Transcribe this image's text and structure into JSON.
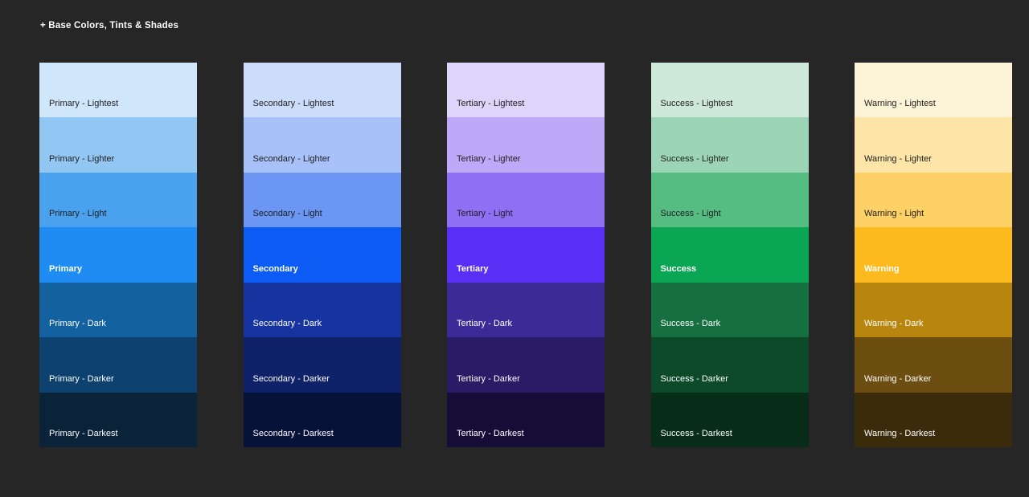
{
  "page": {
    "background": "#262626",
    "title": "+ Base Colors, Tints & Shades",
    "title_color": "#ffffff"
  },
  "palette": {
    "dark_label_color": "#1e1e1e",
    "light_label_color": "#ffffff",
    "columns": [
      {
        "name": "Primary",
        "swatches": [
          {
            "label": "Primary - Lightest",
            "color": "#cfe6fb",
            "text": "#1e1e1e",
            "bold": false
          },
          {
            "label": "Primary - Lighter",
            "color": "#92c7f4",
            "text": "#1e1e1e",
            "bold": false
          },
          {
            "label": "Primary - Light",
            "color": "#4aa2ee",
            "text": "#1e1e1e",
            "bold": false
          },
          {
            "label": "Primary",
            "color": "#1e8cf2",
            "text": "#ffffff",
            "bold": true
          },
          {
            "label": "Primary - Dark",
            "color": "#14619f",
            "text": "#ffffff",
            "bold": false
          },
          {
            "label": "Primary - Darker",
            "color": "#0d4270",
            "text": "#ffffff",
            "bold": false
          },
          {
            "label": "Primary - Darkest",
            "color": "#0a2338",
            "text": "#ffffff",
            "bold": false
          }
        ]
      },
      {
        "name": "Secondary",
        "swatches": [
          {
            "label": "Secondary - Lightest",
            "color": "#ccdcfb",
            "text": "#1e1e1e",
            "bold": false
          },
          {
            "label": "Secondary - Lighter",
            "color": "#a9c1f9",
            "text": "#1e1e1e",
            "bold": false
          },
          {
            "label": "Secondary - Light",
            "color": "#6b96f4",
            "text": "#1e1e1e",
            "bold": false
          },
          {
            "label": "Secondary",
            "color": "#0c5bf5",
            "text": "#ffffff",
            "bold": true
          },
          {
            "label": "Secondary - Dark",
            "color": "#17339f",
            "text": "#ffffff",
            "bold": false
          },
          {
            "label": "Secondary - Darker",
            "color": "#0f2169",
            "text": "#ffffff",
            "bold": false
          },
          {
            "label": "Secondary - Darkest",
            "color": "#071239",
            "text": "#ffffff",
            "bold": false
          }
        ]
      },
      {
        "name": "Tertiary",
        "swatches": [
          {
            "label": "Tertiary - Lightest",
            "color": "#ded6fa",
            "text": "#1e1e1e",
            "bold": false
          },
          {
            "label": "Tertiary - Lighter",
            "color": "#bda9f7",
            "text": "#1e1e1e",
            "bold": false
          },
          {
            "label": "Tertiary - Light",
            "color": "#8f70f5",
            "text": "#1e1e1e",
            "bold": false
          },
          {
            "label": "Tertiary",
            "color": "#5a2ff5",
            "text": "#ffffff",
            "bold": true
          },
          {
            "label": "Tertiary - Dark",
            "color": "#3c2b96",
            "text": "#ffffff",
            "bold": false
          },
          {
            "label": "Tertiary - Darker",
            "color": "#2a1b66",
            "text": "#ffffff",
            "bold": false
          },
          {
            "label": "Tertiary - Darkest",
            "color": "#160c38",
            "text": "#ffffff",
            "bold": false
          }
        ]
      },
      {
        "name": "Success",
        "swatches": [
          {
            "label": "Success - Lightest",
            "color": "#cee9da",
            "text": "#1e1e1e",
            "bold": false
          },
          {
            "label": "Success - Lighter",
            "color": "#9cd5b5",
            "text": "#1e1e1e",
            "bold": false
          },
          {
            "label": "Success - Light",
            "color": "#55bd82",
            "text": "#1e1e1e",
            "bold": false
          },
          {
            "label": "Success",
            "color": "#0ba653",
            "text": "#ffffff",
            "bold": true
          },
          {
            "label": "Success - Dark",
            "color": "#156f40",
            "text": "#ffffff",
            "bold": false
          },
          {
            "label": "Success - Darker",
            "color": "#0d4a2a",
            "text": "#ffffff",
            "bold": false
          },
          {
            "label": "Success - Darkest",
            "color": "#072c18",
            "text": "#ffffff",
            "bold": false
          }
        ]
      },
      {
        "name": "Warning",
        "swatches": [
          {
            "label": "Warning - Lightest",
            "color": "#fdf3d6",
            "text": "#1e1e1e",
            "bold": false
          },
          {
            "label": "Warning - Lighter",
            "color": "#fce5a6",
            "text": "#1e1e1e",
            "bold": false
          },
          {
            "label": "Warning - Light",
            "color": "#fdd166",
            "text": "#1e1e1e",
            "bold": false
          },
          {
            "label": "Warning",
            "color": "#fcba1e",
            "text": "#ffffff",
            "bold": true
          },
          {
            "label": "Warning - Dark",
            "color": "#b8860e",
            "text": "#ffffff",
            "bold": false
          },
          {
            "label": "Warning - Darker",
            "color": "#6b4e10",
            "text": "#ffffff",
            "bold": false
          },
          {
            "label": "Warning - Darkest",
            "color": "#3a2b0b",
            "text": "#ffffff",
            "bold": false
          }
        ]
      }
    ]
  }
}
